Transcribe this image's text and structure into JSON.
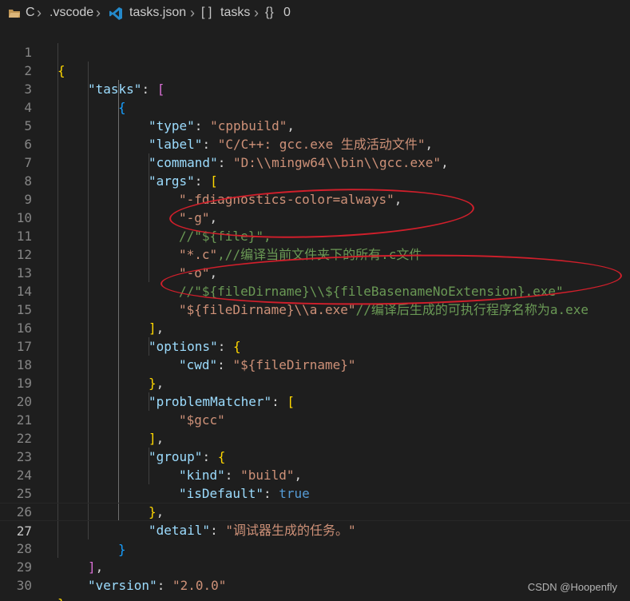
{
  "breadcrumbs": {
    "root": "C",
    "folder": ".vscode",
    "file": "tasks.json",
    "array": "tasks",
    "object": "0"
  },
  "editor": {
    "lines": [
      {
        "num": "1"
      },
      {
        "num": "2"
      },
      {
        "num": "3"
      },
      {
        "num": "4"
      },
      {
        "num": "5"
      },
      {
        "num": "6"
      },
      {
        "num": "7"
      },
      {
        "num": "8"
      },
      {
        "num": "9"
      },
      {
        "num": "10"
      },
      {
        "num": "11"
      },
      {
        "num": "12"
      },
      {
        "num": "13"
      },
      {
        "num": "14"
      },
      {
        "num": "15"
      },
      {
        "num": "16"
      },
      {
        "num": "17"
      },
      {
        "num": "18"
      },
      {
        "num": "19"
      },
      {
        "num": "20"
      },
      {
        "num": "21"
      },
      {
        "num": "22"
      },
      {
        "num": "23"
      },
      {
        "num": "24"
      },
      {
        "num": "25"
      },
      {
        "num": "26"
      },
      {
        "num": "27"
      },
      {
        "num": "28"
      },
      {
        "num": "29"
      },
      {
        "num": "30"
      }
    ],
    "tokens": {
      "l1_brace": "{",
      "l2_key": "\"tasks\"",
      "l2_colon": ": ",
      "l2_bracket": "[",
      "l3_brace": "{",
      "l4_key": "\"type\"",
      "l4_colon": ": ",
      "l4_val": "\"cppbuild\"",
      "l4_comma": ",",
      "l5_key": "\"label\"",
      "l5_colon": ": ",
      "l5_val": "\"C/C++: gcc.exe 生成活动文件\"",
      "l5_comma": ",",
      "l6_key": "\"command\"",
      "l6_colon": ": ",
      "l6_val": "\"D:\\\\mingw64\\\\bin\\\\gcc.exe\"",
      "l6_comma": ",",
      "l7_key": "\"args\"",
      "l7_colon": ": ",
      "l7_bracket": "[",
      "l8_val": "\"-fdiagnostics-color=always\"",
      "l8_comma": ",",
      "l9_val": "\"-g\"",
      "l9_comma": ",",
      "l10_comment": "//\"${file}\",",
      "l11_val": "\"*.c\"",
      "l11_comment": ",//编译当前文件夹下的所有.c文件",
      "l12_val": "\"-o\"",
      "l12_comma": ",",
      "l13_comment": "//\"${fileDirname}\\\\${fileBasenameNoExtension}.exe\"",
      "l14_val": "\"${fileDirname}\\\\a.exe\"",
      "l14_comment": "//编译后生成的可执行程序名称为a.exe",
      "l15_bracket": "]",
      "l15_comma": ",",
      "l16_key": "\"options\"",
      "l16_colon": ": ",
      "l16_brace": "{",
      "l17_key": "\"cwd\"",
      "l17_colon": ": ",
      "l17_val": "\"${fileDirname}\"",
      "l18_brace": "}",
      "l18_comma": ",",
      "l19_key": "\"problemMatcher\"",
      "l19_colon": ": ",
      "l19_bracket": "[",
      "l20_val": "\"$gcc\"",
      "l21_bracket": "]",
      "l21_comma": ",",
      "l22_key": "\"group\"",
      "l22_colon": ": ",
      "l22_brace": "{",
      "l23_key": "\"kind\"",
      "l23_colon": ": ",
      "l23_val": "\"build\"",
      "l23_comma": ",",
      "l24_key": "\"isDefault\"",
      "l24_colon": ": ",
      "l24_val": "true",
      "l25_brace": "}",
      "l25_comma": ",",
      "l26_key": "\"detail\"",
      "l26_colon": ": ",
      "l26_val": "\"调试器生成的任务。\"",
      "l27_brace": "}",
      "l28_bracket": "]",
      "l28_comma": ",",
      "l29_key": "\"version\"",
      "l29_colon": ": ",
      "l29_val": "\"2.0.0\"",
      "l30_brace": "}"
    }
  },
  "watermark": "CSDN @Hoopenfly",
  "colors": {
    "background": "#1e1e1e",
    "key": "#9cdcfe",
    "string": "#ce9178",
    "comment": "#6a9955",
    "keyword": "#569cd6",
    "annotation": "#d11f2b"
  }
}
